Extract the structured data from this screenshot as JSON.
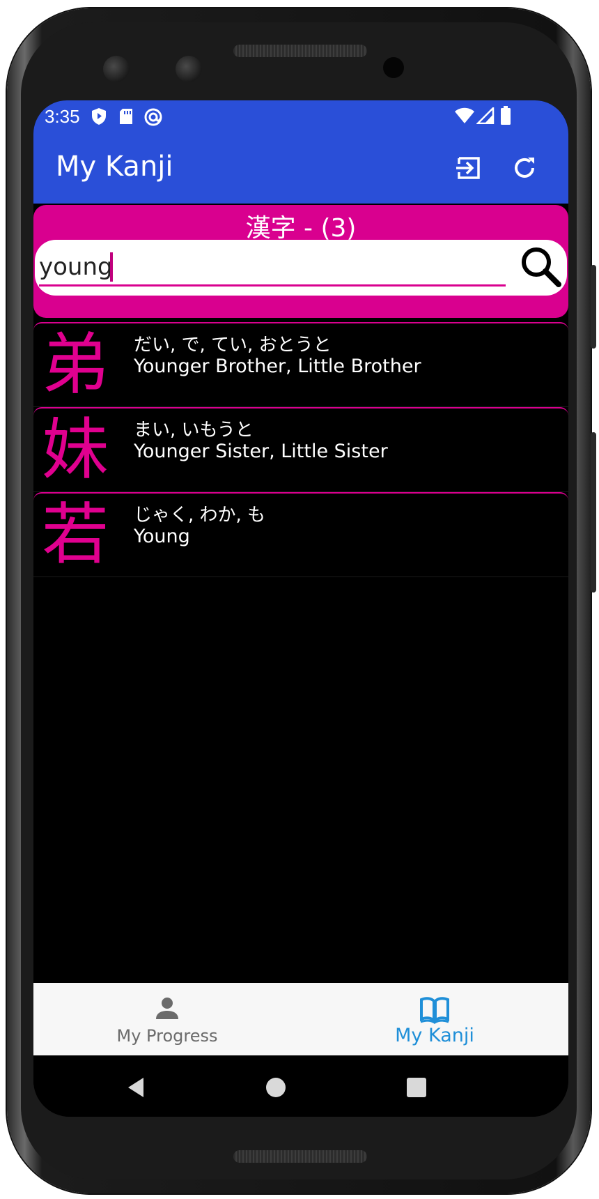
{
  "status_bar": {
    "time": "3:35"
  },
  "app_bar": {
    "title": "My Kanji"
  },
  "header": {
    "title": "漢字 - (3)"
  },
  "search": {
    "value": "young"
  },
  "results": [
    {
      "kanji": "弟",
      "reading": "だい, で, てい, おとうと",
      "meaning": "Younger Brother, Little Brother"
    },
    {
      "kanji": "妹",
      "reading": "まい, いもうと",
      "meaning": "Younger Sister, Little Sister"
    },
    {
      "kanji": "若",
      "reading": "じゃく, わか, も",
      "meaning": "Young"
    }
  ],
  "bottom_nav": {
    "items": [
      {
        "label": "My Progress",
        "icon": "person-icon",
        "active": false
      },
      {
        "label": "My Kanji",
        "icon": "book-icon",
        "active": true
      }
    ]
  },
  "colors": {
    "primary": "#2a4fd8",
    "accent": "#d9008f",
    "kanji": "#e0008f",
    "nav_active": "#1f8fd8"
  }
}
